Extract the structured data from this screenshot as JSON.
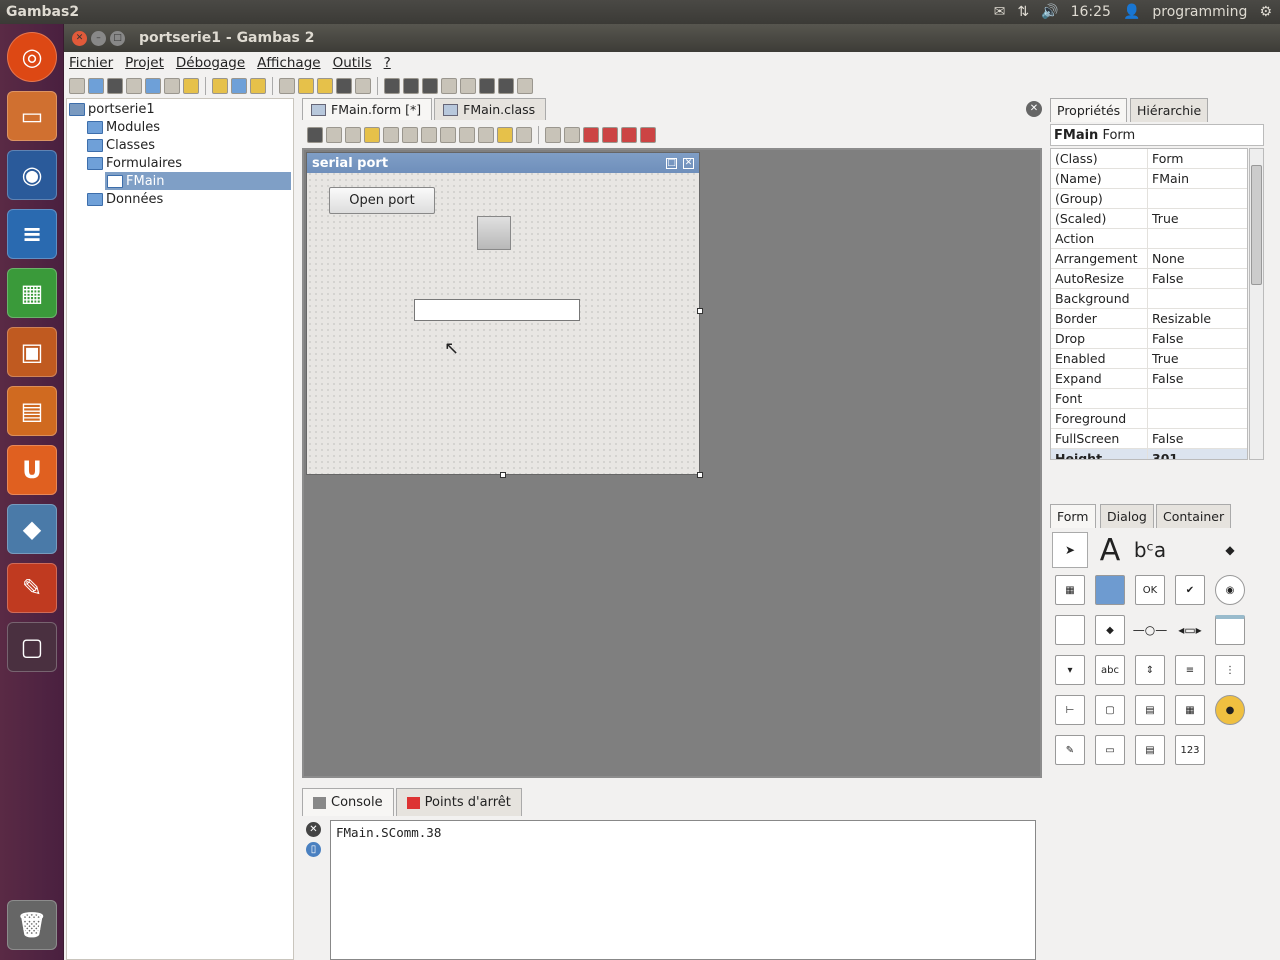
{
  "topbar": {
    "app_name": "Gambas2",
    "time": "16:25",
    "user": "programming"
  },
  "window": {
    "title": "portserie1 - Gambas 2"
  },
  "menu": [
    "Fichier",
    "Projet",
    "Débogage",
    "Affichage",
    "Outils",
    "?"
  ],
  "project_tree": {
    "root": "portserie1",
    "items": [
      "Modules",
      "Classes",
      "Formulaires",
      "FMain",
      "Données"
    ]
  },
  "editor_tabs": [
    {
      "label": "FMain.form [*]"
    },
    {
      "label": "FMain.class"
    }
  ],
  "form": {
    "title": "serial port",
    "button_label": "Open port"
  },
  "bottom_tabs": [
    {
      "label": "Console"
    },
    {
      "label": "Points d'arrêt"
    }
  ],
  "console_output": "FMain.SComm.38",
  "right_tabs": [
    "Propriétés",
    "Hiérarchie"
  ],
  "properties_header": {
    "name": "FMain",
    "class": "Form"
  },
  "properties": [
    {
      "name": "(Class)",
      "value": "Form"
    },
    {
      "name": "(Name)",
      "value": "FMain"
    },
    {
      "name": "(Group)",
      "value": ""
    },
    {
      "name": "(Scaled)",
      "value": "True"
    },
    {
      "name": "Action",
      "value": ""
    },
    {
      "name": "Arrangement",
      "value": "None"
    },
    {
      "name": "AutoResize",
      "value": "False"
    },
    {
      "name": "Background",
      "value": ""
    },
    {
      "name": "Border",
      "value": "Resizable"
    },
    {
      "name": "Drop",
      "value": "False"
    },
    {
      "name": "Enabled",
      "value": "True"
    },
    {
      "name": "Expand",
      "value": "False"
    },
    {
      "name": "Font",
      "value": ""
    },
    {
      "name": "Foreground",
      "value": ""
    },
    {
      "name": "FullScreen",
      "value": "False"
    },
    {
      "name": "Height",
      "value": "301"
    }
  ],
  "component_tabs": [
    "Form",
    "Dialog",
    "Container"
  ],
  "palette_labels": {
    "label_a": "A",
    "text_label": "bᶜa",
    "ok": "OK",
    "abc": "abc",
    "num": "123"
  }
}
